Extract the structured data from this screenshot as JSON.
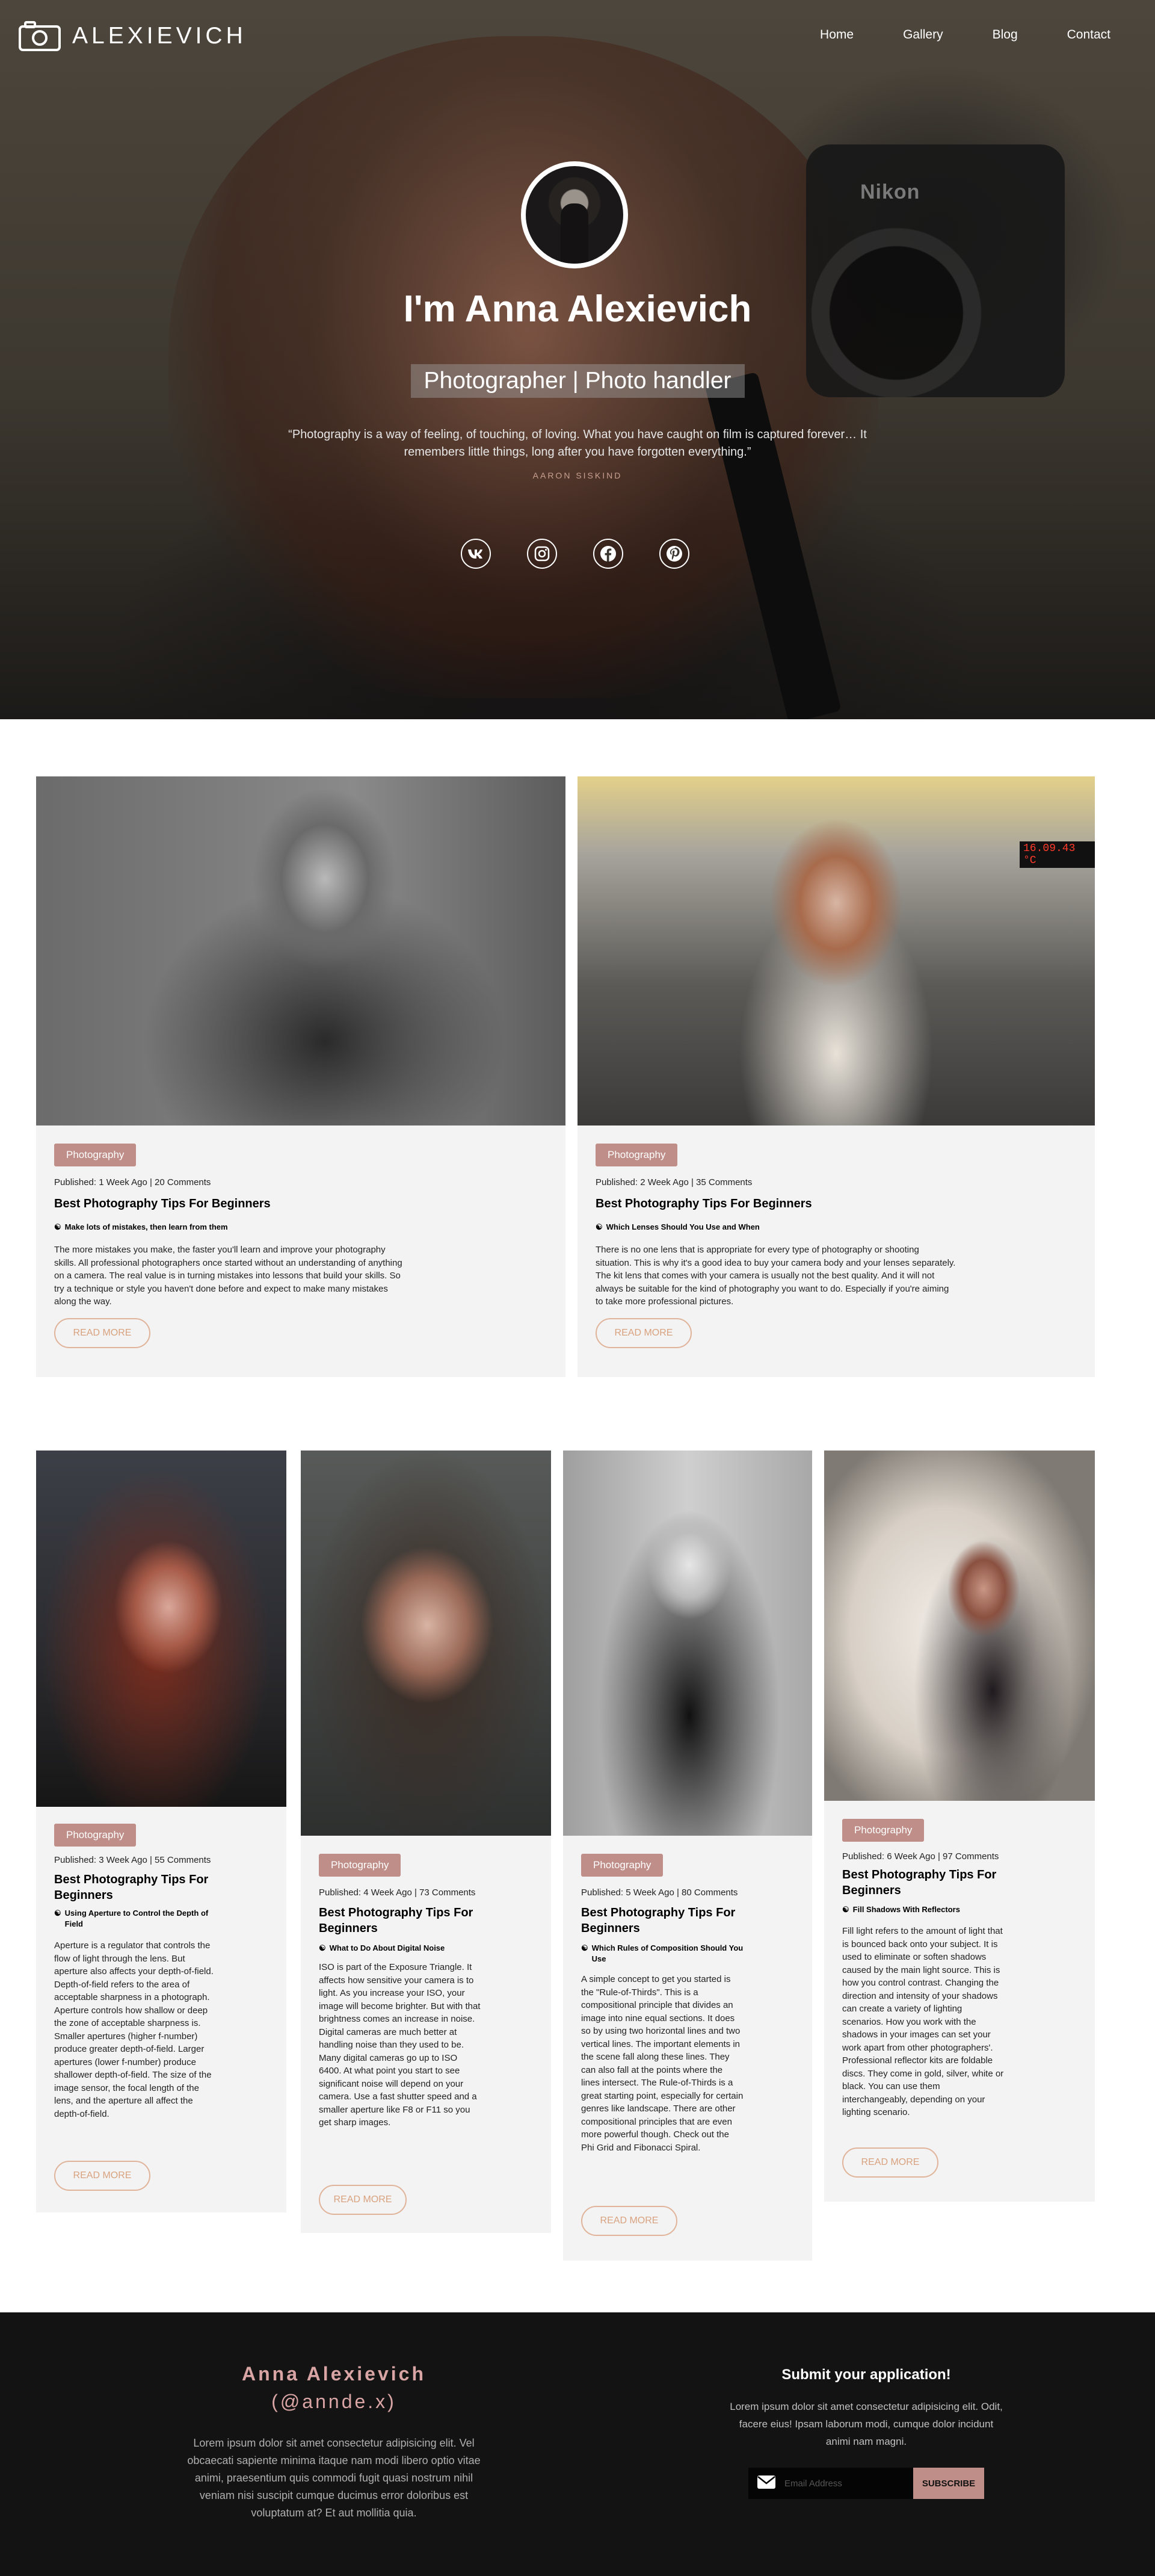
{
  "brand": {
    "name": "ALEXIEVICH",
    "icon": "camera-icon"
  },
  "nav": {
    "links": [
      "Home",
      "Gallery",
      "Blog",
      "Contact"
    ]
  },
  "hero": {
    "camera_brand": "Nikon",
    "title": "I'm  Anna Alexievich",
    "subtitle": "Photographer | Photo handler",
    "quote": "“Photography is a way of feeling, of touching, of loving. What you have caught on film is captured forever… It remembers little things, long after you have forgotten everything.”",
    "author": "AARON SISKIND",
    "socials": [
      "vk-icon",
      "instagram-icon",
      "facebook-icon",
      "pinterest-icon"
    ]
  },
  "posts": [
    {
      "badge": "Photography",
      "meta": "Published: 1 Week Ago | 20 Comments",
      "title": "Best Photography Tips For Beginners",
      "sub": "Make lots of mistakes, then learn from them",
      "body": "The more mistakes you make, the faster you'll learn and improve your photography skills. All professional photographers once started without an understanding of anything on a camera. The real value is in turning mistakes into lessons that build your skills. So try a technique or style you haven't done before and expect to make many mistakes along the way.",
      "button": "READ MORE"
    },
    {
      "badge": "Photography",
      "meta": "Published: 2 Week Ago | 35 Comments",
      "title": "Best Photography Tips For Beginners",
      "sub": "Which Lenses Should You Use and When",
      "body": "There is no one lens that is appropriate for every type of photography or shooting situation. This is why it's a good idea to buy your camera body and your lenses separately. The kit lens that comes with your camera is usually not the best quality. And it will not always be suitable for the kind of photography you want to do. Especially if you're aiming to take more professional pictures.",
      "button": "READ MORE",
      "photo_text": "16.09.43 °C"
    },
    {
      "badge": "Photography",
      "meta": "Published: 3 Week Ago | 55 Comments",
      "title": "Best Photography Tips For Beginners",
      "sub": "Using Aperture to Control the Depth of Field",
      "body": "Aperture is a regulator that controls the flow of light through the lens. But aperture also affects your depth-of-field. Depth-of-field refers to the area of acceptable sharpness in a photograph. Aperture controls how shallow or deep the zone of acceptable sharpness is. Smaller apertures (higher f-number) produce greater depth-of-field. Larger apertures (lower f-number) produce shallower depth-of-field. The size of the image sensor, the focal length of the lens, and the aperture all affect the depth-of-field.",
      "button": "READ MORE"
    },
    {
      "badge": "Photography",
      "meta": "Published: 4 Week Ago | 73 Comments",
      "title": "Best Photography Tips For Beginners",
      "sub": "What to Do About Digital Noise",
      "body": "ISO is part of the Exposure Triangle. It affects how sensitive your camera is to light. As you increase your ISO, your image will become brighter. But with that brightness comes an increase in noise. Digital cameras are much better at handling noise than they used to be. Many digital cameras go up to ISO 6400. At what point you start to see significant noise will depend on your camera. Use a fast shutter speed and a smaller aperture like F8 or F11 so you get sharp images.",
      "button": "READ MORE"
    },
    {
      "badge": "Photography",
      "meta": "Published: 5 Week Ago | 80 Comments",
      "title": "Best Photography Tips For Beginners",
      "sub": "Which Rules of Composition Should You Use",
      "body": "A simple concept to get you started is the \"Rule-of-Thirds\". This is a compositional principle that divides an image into nine equal sections. It does so by using two horizontal lines and two vertical lines. The important elements in the scene fall along these lines. They can also fall at the points where the lines intersect. The Rule-of-Thirds is a great starting point, especially for certain genres like landscape. There are other compositional principles that are even more powerful though. Check out the Phi Grid and Fibonacci Spiral.",
      "button": "READ MORE"
    },
    {
      "badge": "Photography",
      "meta": "Published: 6 Week Ago | 97 Comments",
      "title": "Best Photography Tips For Beginners",
      "sub": "Fill Shadows With Reflectors",
      "body": "Fill light refers to the amount of light that is bounced back onto your subject. It is used to eliminate or soften shadows caused by the main light source. This is how you control contrast. Changing the direction and intensity of your shadows can create a variety of lighting scenarios. How you work with the shadows in your images can set your work apart from other photographers'. Professional reflector kits are foldable discs. They come in gold, silver, white or black. You can use them interchangeably, depending on your lighting scenario.",
      "button": "READ MORE"
    }
  ],
  "footer": {
    "name": "Anna Alexievich",
    "handle": "(@annde.x)",
    "text": "Lorem ipsum dolor sit amet consectetur adipisicing elit. Vel obcaecati sapiente minima itaque nam modi libero optio vitae animi, praesentium quis commodi fugit quasi nostrum nihil veniam nisi suscipit cumque ducimus error doloribus est voluptatum at? Et aut mollitia quia.",
    "subscribe_title": "Submit your application!",
    "subscribe_desc": "Lorem ipsum dolor sit amet consectetur adipisicing elit. Odit, facere eius! Ipsam laborum modi, cumque dolor incidunt animi nam magni.",
    "email_placeholder": "Email Address",
    "subscribe_button": "SUBSCRIBE"
  },
  "colors": {
    "accent": "#c08e88",
    "button_outline": "#e0b49a",
    "footer_bg": "#131313",
    "card_bg": "#f3f3f3"
  }
}
